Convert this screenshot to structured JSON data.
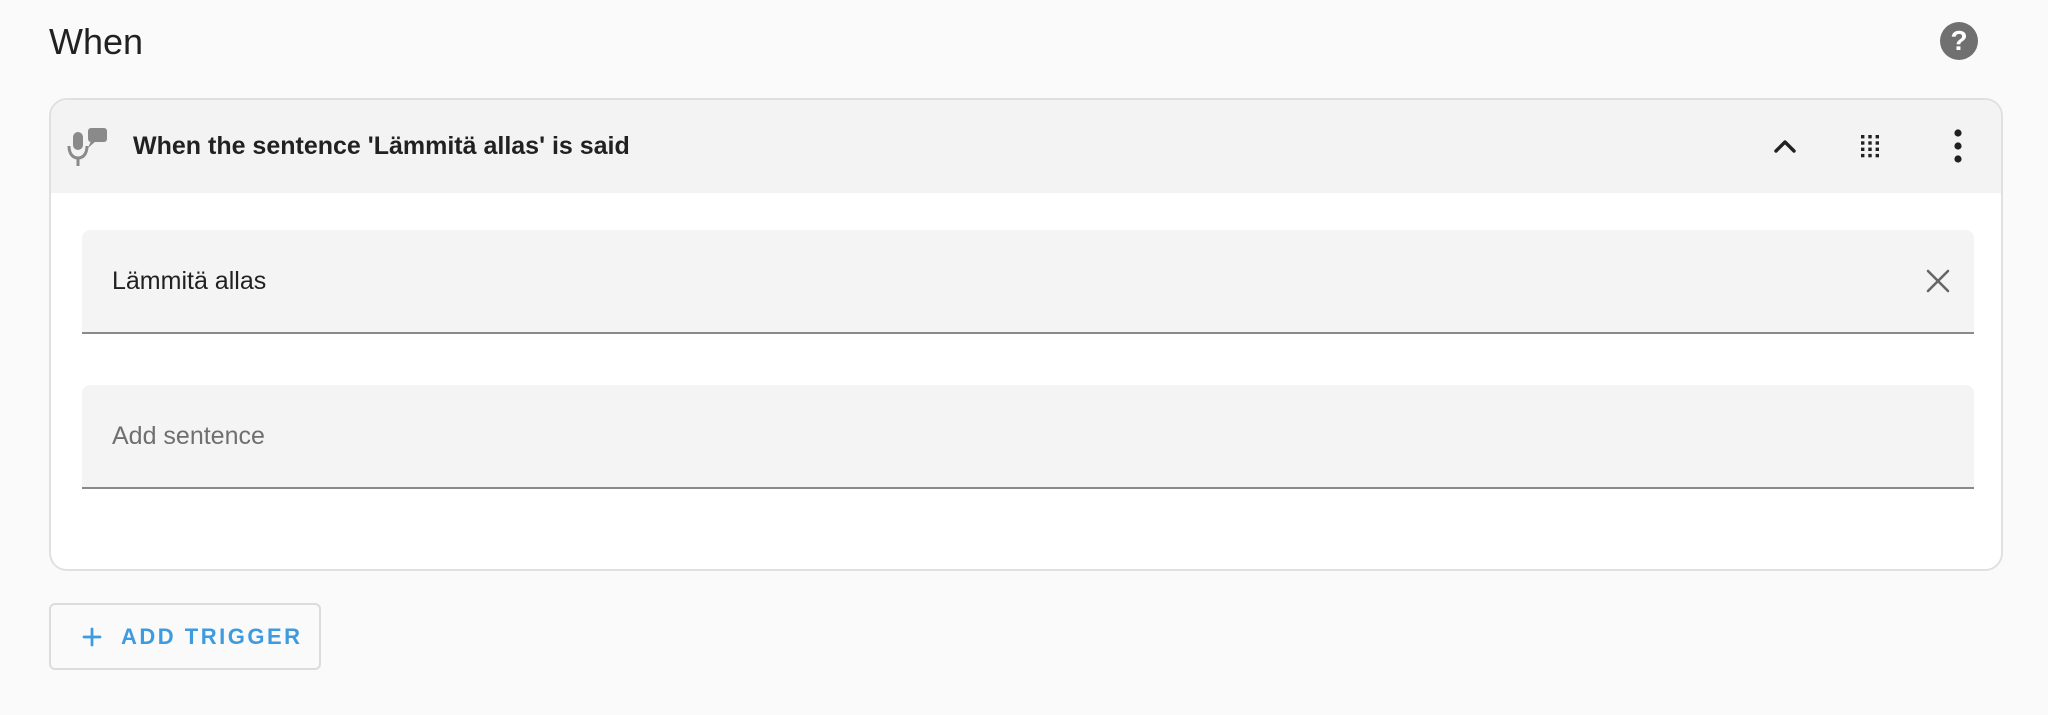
{
  "section": {
    "title": "When",
    "help_icon": "help-circle-icon",
    "help_glyph": "?"
  },
  "trigger": {
    "icon": "microphone-message-icon",
    "title": "When the sentence 'Lämmitä allas' is said",
    "collapse_icon": "chevron-up-icon",
    "drag_icon": "drag-handle-icon",
    "more_icon": "dots-vertical-icon",
    "sentences": [
      "Lämmitä allas"
    ],
    "clear_icon": "close-icon",
    "add_sentence": {
      "value": "",
      "placeholder": "Add sentence"
    }
  },
  "add_trigger": {
    "icon": "plus-icon",
    "label": "ADD TRIGGER"
  },
  "colors": {
    "accent": "#3d9be0",
    "header_bg": "#f3f3f3",
    "field_bg": "#f4f4f4",
    "page_bg": "#fafafa",
    "icon_gray": "#707070"
  }
}
